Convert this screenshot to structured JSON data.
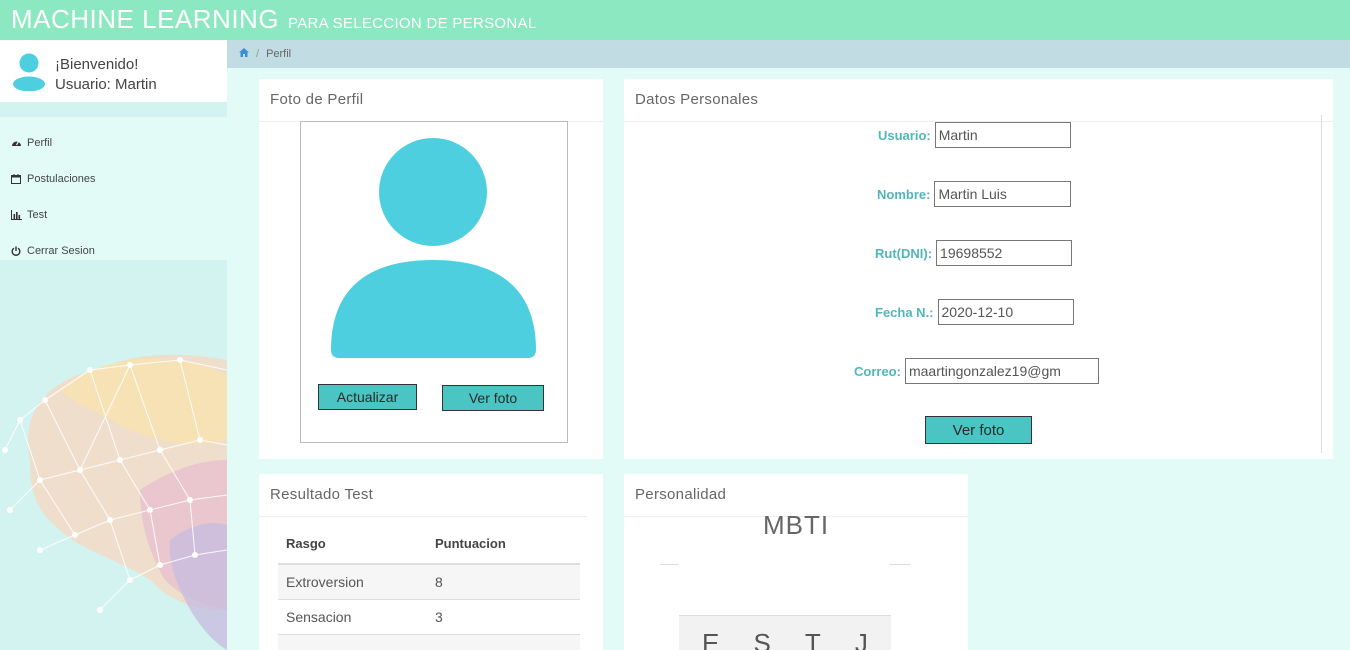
{
  "header": {
    "title": "MACHINE LEARNING",
    "subtitle": "PARA SELECCION DE PERSONAL"
  },
  "sidebar": {
    "welcome": "¡Bienvenido!",
    "user_line": "Usuario: Martin",
    "items": [
      {
        "label": "Perfil",
        "icon": "dashboard-icon"
      },
      {
        "label": "Postulaciones",
        "icon": "calendar-icon"
      },
      {
        "label": "Test",
        "icon": "bar-chart-icon"
      },
      {
        "label": "Cerrar Sesion",
        "icon": "power-icon"
      }
    ]
  },
  "breadcrumb": {
    "home_icon": "home-icon",
    "current": "Perfil"
  },
  "profile_photo": {
    "title": "Foto de Perfil",
    "update_button": "Actualizar",
    "view_button": "Ver foto"
  },
  "personal_data": {
    "title": "Datos Personales",
    "fields": [
      {
        "label": "Usuario:",
        "value": "Martin"
      },
      {
        "label": "Nombre:",
        "value": "Martin Luis"
      },
      {
        "label": "Rut(DNI):",
        "value": "19698552"
      },
      {
        "label": "Fecha N.:",
        "value": "2020-12-10"
      },
      {
        "label": "Correo:",
        "value": "maartingonzalez19@gm"
      }
    ],
    "view_button": "Ver foto"
  },
  "test_results": {
    "title": "Resultado Test",
    "headers": [
      "Rasgo",
      "Puntuacion"
    ],
    "rows": [
      {
        "trait": "Extroversion",
        "score": "8"
      },
      {
        "trait": "Sensacion",
        "score": "3"
      }
    ]
  },
  "personality": {
    "title": "Personalidad",
    "mbti_title": "MBTI",
    "letters": [
      "E",
      "S",
      "T",
      "J"
    ]
  },
  "colors": {
    "topbar": "#8ce8c1",
    "accent": "#4ecfdf",
    "button": "#4bc4c4",
    "label": "#52b6b8",
    "background": "#e3fbf7"
  }
}
